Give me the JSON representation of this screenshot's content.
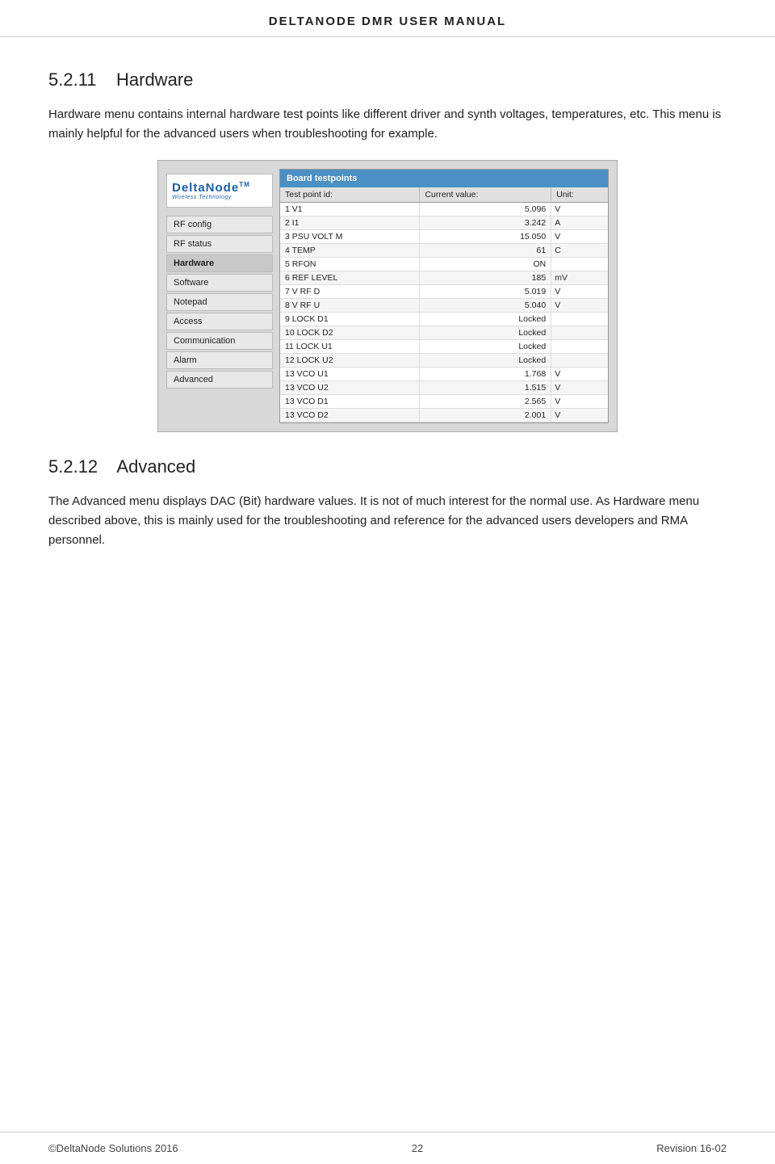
{
  "header": {
    "title": "DELTANODE DMR USER MANUAL"
  },
  "section1": {
    "number": "5.2.11",
    "title": "Hardware",
    "body1": "Hardware menu contains internal hardware test points like different driver and synth voltages, temperatures, etc. This menu is mainly helpful for the advanced users when troubleshooting for example."
  },
  "screenshot": {
    "logo": {
      "brand": "DeltaNode",
      "tm": "TM",
      "tagline": "Wireless  Technology"
    },
    "menu_items": [
      {
        "label": "RF config",
        "active": false
      },
      {
        "label": "RF status",
        "active": false
      },
      {
        "label": "Hardware",
        "active": true
      },
      {
        "label": "Software",
        "active": false
      },
      {
        "label": "Notepad",
        "active": false
      },
      {
        "label": "Access",
        "active": false
      },
      {
        "label": "Communication",
        "active": false
      },
      {
        "label": "Alarm",
        "active": false
      },
      {
        "label": "Advanced",
        "active": false
      }
    ],
    "table_header": "Board testpoints",
    "columns": [
      "Test point id:",
      "Current value:",
      "Unit:"
    ],
    "rows": [
      {
        "id": "1 V1",
        "value": "5.096",
        "unit": "V"
      },
      {
        "id": "2 I1",
        "value": "3.242",
        "unit": "A"
      },
      {
        "id": "3 PSU VOLT M",
        "value": "15.050",
        "unit": "V"
      },
      {
        "id": "4 TEMP",
        "value": "61",
        "unit": "C"
      },
      {
        "id": "5 RFON",
        "value": "ON",
        "unit": ""
      },
      {
        "id": "6 REF LEVEL",
        "value": "185",
        "unit": "mV"
      },
      {
        "id": "7 V RF D",
        "value": "5.019",
        "unit": "V"
      },
      {
        "id": "8 V RF U",
        "value": "5.040",
        "unit": "V"
      },
      {
        "id": "9 LOCK D1",
        "value": "Locked",
        "unit": ""
      },
      {
        "id": "10 LOCK D2",
        "value": "Locked",
        "unit": ""
      },
      {
        "id": "11 LOCK U1",
        "value": "Locked",
        "unit": ""
      },
      {
        "id": "12 LOCK U2",
        "value": "Locked",
        "unit": ""
      },
      {
        "id": "13 VCO U1",
        "value": "1.768",
        "unit": "V"
      },
      {
        "id": "13 VCO U2",
        "value": "1.515",
        "unit": "V"
      },
      {
        "id": "13 VCO D1",
        "value": "2.565",
        "unit": "V"
      },
      {
        "id": "13 VCO D2",
        "value": "2.001",
        "unit": "V"
      }
    ]
  },
  "section2": {
    "number": "5.2.12",
    "title": "Advanced",
    "body1": "The Advanced menu displays DAC (Bit) hardware values. It is not of much interest for the normal use. As Hardware menu described above, this is mainly used for the troubleshooting and reference for the advanced users developers and RMA personnel."
  },
  "footer": {
    "copyright": "©DeltaNode Solutions 2016",
    "page": "22",
    "revision": "Revision 16-02"
  }
}
